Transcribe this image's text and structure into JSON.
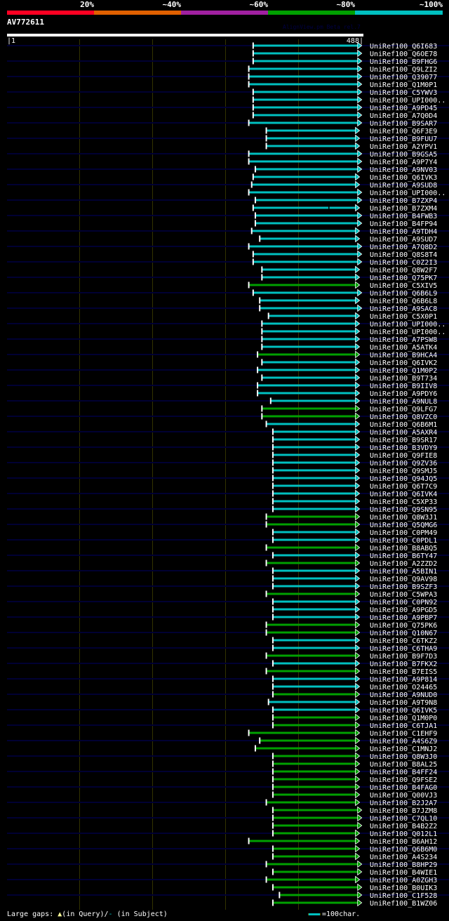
{
  "query": {
    "name": "AV772611",
    "length": 488,
    "start_label": "|1",
    "end_label": "488|"
  },
  "credit": "AlignView.pm Beta rel.7",
  "identity_bins": [
    {
      "label": "20%",
      "color": "#ff0022"
    },
    {
      "label": "~40%",
      "color": "#e06000"
    },
    {
      "label": "~60%",
      "color": "#a020a0"
    },
    {
      "label": "~80%",
      "color": "#00a000"
    },
    {
      "label": "~100%",
      "color": "#00c0c0"
    }
  ],
  "grid_every": 100,
  "footer": {
    "prefix": "Large gaps:",
    "query_gap": "▲",
    "query_text": "(in Query)/",
    "subject_gap": "-",
    "subject_text": " (in Subject)",
    "scale_label": "=100char."
  },
  "hits": [
    {
      "id": "UniRef100_Q6I683",
      "start": 338,
      "end": 481,
      "bin": "~100%"
    },
    {
      "id": "UniRef100_Q6OE78",
      "start": 338,
      "end": 481,
      "bin": "~100%"
    },
    {
      "id": "UniRef100_B9FHG6",
      "start": 338,
      "end": 481,
      "bin": "~100%"
    },
    {
      "id": "UniRef100_Q9LZI2",
      "start": 332,
      "end": 481,
      "bin": "~100%"
    },
    {
      "id": "UniRef100_Q39077",
      "start": 332,
      "end": 481,
      "bin": "~100%"
    },
    {
      "id": "UniRef100_Q1M0P1",
      "start": 332,
      "end": 481,
      "bin": "~100%"
    },
    {
      "id": "UniRef100_C5YWV3",
      "start": 338,
      "end": 481,
      "bin": "~100%"
    },
    {
      "id": "UniRef100_UPI000..",
      "start": 338,
      "end": 481,
      "bin": "~100%"
    },
    {
      "id": "UniRef100_A9PD45",
      "start": 338,
      "end": 481,
      "bin": "~100%"
    },
    {
      "id": "UniRef100_A7Q0D4",
      "start": 338,
      "end": 481,
      "bin": "~100%"
    },
    {
      "id": "UniRef100_B9SAR7",
      "start": 332,
      "end": 481,
      "bin": "~100%"
    },
    {
      "id": "UniRef100_Q6F3E9",
      "start": 356,
      "end": 478,
      "bin": "~100%"
    },
    {
      "id": "UniRef100_B9FUU7",
      "start": 356,
      "end": 478,
      "bin": "~100%"
    },
    {
      "id": "UniRef100_A2YPV1",
      "start": 356,
      "end": 478,
      "bin": "~100%"
    },
    {
      "id": "UniRef100_B9GSA5",
      "start": 332,
      "end": 481,
      "bin": "~100%"
    },
    {
      "id": "UniRef100_A9P7Y4",
      "start": 332,
      "end": 481,
      "bin": "~100%"
    },
    {
      "id": "UniRef100_A9NV03",
      "start": 341,
      "end": 481,
      "bin": "~100%"
    },
    {
      "id": "UniRef100_Q6IVK3",
      "start": 338,
      "end": 478,
      "bin": "~100%"
    },
    {
      "id": "UniRef100_A9SUD8",
      "start": 336,
      "end": 478,
      "bin": "~100%"
    },
    {
      "id": "UniRef100_UPI000..",
      "start": 332,
      "end": 481,
      "bin": "~100%"
    },
    {
      "id": "UniRef100_B7ZXP4",
      "start": 341,
      "end": 481,
      "bin": "~100%"
    },
    {
      "id": "UniRef100_B7ZXM4",
      "start": 338,
      "end": 478,
      "bin": "~100%",
      "subject_gap": 441
    },
    {
      "id": "UniRef100_B4FWB3",
      "start": 341,
      "end": 481,
      "bin": "~100%"
    },
    {
      "id": "UniRef100_B4FP94",
      "start": 341,
      "end": 481,
      "bin": "~100%"
    },
    {
      "id": "UniRef100_A9TDH4",
      "start": 336,
      "end": 478,
      "bin": "~100%"
    },
    {
      "id": "UniRef100_A9SUD7",
      "start": 347,
      "end": 478,
      "bin": "~100%"
    },
    {
      "id": "UniRef100_A7Q8D2",
      "start": 332,
      "end": 481,
      "bin": "~100%"
    },
    {
      "id": "UniRef100_Q8S8T4",
      "start": 338,
      "end": 481,
      "bin": "~100%"
    },
    {
      "id": "UniRef100_C0Z2I3",
      "start": 338,
      "end": 481,
      "bin": "~100%"
    },
    {
      "id": "UniRef100_Q8W2F7",
      "start": 350,
      "end": 478,
      "bin": "~100%"
    },
    {
      "id": "UniRef100_Q75PK7",
      "start": 350,
      "end": 478,
      "bin": "~100%"
    },
    {
      "id": "UniRef100_C5XIV5",
      "start": 332,
      "end": 478,
      "bin": "~80%"
    },
    {
      "id": "UniRef100_Q6B6L9",
      "start": 338,
      "end": 481,
      "bin": "~100%"
    },
    {
      "id": "UniRef100_Q6B6L8",
      "start": 347,
      "end": 478,
      "bin": "~100%"
    },
    {
      "id": "UniRef100_A9SAC8",
      "start": 347,
      "end": 481,
      "bin": "~100%"
    },
    {
      "id": "UniRef100_C5X0P1",
      "start": 359,
      "end": 478,
      "bin": "~100%"
    },
    {
      "id": "UniRef100_UPI000..",
      "start": 350,
      "end": 478,
      "bin": "~100%"
    },
    {
      "id": "UniRef100_UPI000..",
      "start": 350,
      "end": 478,
      "bin": "~100%"
    },
    {
      "id": "UniRef100_A7PSW8",
      "start": 350,
      "end": 478,
      "bin": "~100%"
    },
    {
      "id": "UniRef100_A5ATK4",
      "start": 350,
      "end": 478,
      "bin": "~100%"
    },
    {
      "id": "UniRef100_B9HCA4",
      "start": 344,
      "end": 478,
      "bin": "~80%"
    },
    {
      "id": "UniRef100_Q6IVK2",
      "start": 350,
      "end": 478,
      "bin": "~100%"
    },
    {
      "id": "UniRef100_Q1M0P2",
      "start": 344,
      "end": 478,
      "bin": "~100%"
    },
    {
      "id": "UniRef100_B9T734",
      "start": 350,
      "end": 478,
      "bin": "~100%"
    },
    {
      "id": "UniRef100_B9IIV8",
      "start": 344,
      "end": 478,
      "bin": "~100%"
    },
    {
      "id": "UniRef100_A9PDY6",
      "start": 344,
      "end": 478,
      "bin": "~100%"
    },
    {
      "id": "UniRef100_A9NUL8",
      "start": 362,
      "end": 478,
      "bin": "~100%"
    },
    {
      "id": "UniRef100_Q9LFG7",
      "start": 350,
      "end": 478,
      "bin": "~80%"
    },
    {
      "id": "UniRef100_Q8VZC0",
      "start": 350,
      "end": 478,
      "bin": "~80%"
    },
    {
      "id": "UniRef100_Q6B6M1",
      "start": 356,
      "end": 478,
      "bin": "~100%"
    },
    {
      "id": "UniRef100_A5AXR4",
      "start": 365,
      "end": 478,
      "bin": "~100%"
    },
    {
      "id": "UniRef100_B9SR17",
      "start": 365,
      "end": 478,
      "bin": "~100%"
    },
    {
      "id": "UniRef100_B3VDY9",
      "start": 365,
      "end": 478,
      "bin": "~100%"
    },
    {
      "id": "UniRef100_Q9FIE8",
      "start": 365,
      "end": 478,
      "bin": "~100%"
    },
    {
      "id": "UniRef100_Q9ZV36",
      "start": 365,
      "end": 478,
      "bin": "~100%"
    },
    {
      "id": "UniRef100_Q9SMJ5",
      "start": 365,
      "end": 478,
      "bin": "~100%"
    },
    {
      "id": "UniRef100_Q94JQ5",
      "start": 365,
      "end": 478,
      "bin": "~100%"
    },
    {
      "id": "UniRef100_Q6T7C9",
      "start": 365,
      "end": 478,
      "bin": "~100%"
    },
    {
      "id": "UniRef100_Q6IVK4",
      "start": 365,
      "end": 478,
      "bin": "~100%"
    },
    {
      "id": "UniRef100_C5XP33",
      "start": 365,
      "end": 478,
      "bin": "~100%"
    },
    {
      "id": "UniRef100_Q9SN95",
      "start": 365,
      "end": 478,
      "bin": "~100%"
    },
    {
      "id": "UniRef100_Q8W3J1",
      "start": 356,
      "end": 478,
      "bin": "~80%"
    },
    {
      "id": "UniRef100_Q5QMG6",
      "start": 356,
      "end": 478,
      "bin": "~80%"
    },
    {
      "id": "UniRef100_C0PM49",
      "start": 365,
      "end": 478,
      "bin": "~100%"
    },
    {
      "id": "UniRef100_C0PDL1",
      "start": 365,
      "end": 478,
      "bin": "~100%"
    },
    {
      "id": "UniRef100_B8ABQ5",
      "start": 356,
      "end": 478,
      "bin": "~80%"
    },
    {
      "id": "UniRef100_B6TY47",
      "start": 365,
      "end": 478,
      "bin": "~100%"
    },
    {
      "id": "UniRef100_A2ZZD2",
      "start": 356,
      "end": 478,
      "bin": "~80%"
    },
    {
      "id": "UniRef100_A5BIN1",
      "start": 365,
      "end": 478,
      "bin": "~100%"
    },
    {
      "id": "UniRef100_Q9AV98",
      "start": 365,
      "end": 478,
      "bin": "~100%"
    },
    {
      "id": "UniRef100_B9SZF3",
      "start": 365,
      "end": 478,
      "bin": "~100%"
    },
    {
      "id": "UniRef100_C5WPA3",
      "start": 356,
      "end": 478,
      "bin": "~80%"
    },
    {
      "id": "UniRef100_C0PN92",
      "start": 365,
      "end": 478,
      "bin": "~100%"
    },
    {
      "id": "UniRef100_A9PGD5",
      "start": 365,
      "end": 478,
      "bin": "~100%"
    },
    {
      "id": "UniRef100_A9PBP7",
      "start": 365,
      "end": 478,
      "bin": "~100%"
    },
    {
      "id": "UniRef100_Q75PK6",
      "start": 356,
      "end": 478,
      "bin": "~80%"
    },
    {
      "id": "UniRef100_Q10N67",
      "start": 356,
      "end": 478,
      "bin": "~80%"
    },
    {
      "id": "UniRef100_C6TKZ2",
      "start": 365,
      "end": 478,
      "bin": "~100%"
    },
    {
      "id": "UniRef100_C6THA9",
      "start": 365,
      "end": 478,
      "bin": "~100%"
    },
    {
      "id": "UniRef100_B9F7D3",
      "start": 356,
      "end": 478,
      "bin": "~80%"
    },
    {
      "id": "UniRef100_B7FKX2",
      "start": 365,
      "end": 478,
      "bin": "~100%"
    },
    {
      "id": "UniRef100_B7EIS5",
      "start": 356,
      "end": 478,
      "bin": "~80%"
    },
    {
      "id": "UniRef100_A9P814",
      "start": 365,
      "end": 478,
      "bin": "~100%"
    },
    {
      "id": "UniRef100_O24465",
      "start": 365,
      "end": 478,
      "bin": "~100%"
    },
    {
      "id": "UniRef100_A9NUD0",
      "start": 365,
      "end": 478,
      "bin": "~80%"
    },
    {
      "id": "UniRef100_A9T9N8",
      "start": 359,
      "end": 478,
      "bin": "~100%"
    },
    {
      "id": "UniRef100_Q6IVK5",
      "start": 365,
      "end": 478,
      "bin": "~100%"
    },
    {
      "id": "UniRef100_Q1M0P0",
      "start": 365,
      "end": 478,
      "bin": "~80%"
    },
    {
      "id": "UniRef100_C6TJA1",
      "start": 365,
      "end": 478,
      "bin": "~80%"
    },
    {
      "id": "UniRef100_C1EHF9",
      "start": 332,
      "end": 478,
      "bin": "~80%"
    },
    {
      "id": "UniRef100_A4S6Z9",
      "start": 347,
      "end": 478,
      "bin": "~80%"
    },
    {
      "id": "UniRef100_C1MNJ2",
      "start": 341,
      "end": 478,
      "bin": "~80%"
    },
    {
      "id": "UniRef100_Q8W3J0",
      "start": 365,
      "end": 478,
      "bin": "~80%"
    },
    {
      "id": "UniRef100_B8AL25",
      "start": 365,
      "end": 478,
      "bin": "~80%"
    },
    {
      "id": "UniRef100_B4FF24",
      "start": 365,
      "end": 478,
      "bin": "~80%"
    },
    {
      "id": "UniRef100_Q9FSE2",
      "start": 365,
      "end": 478,
      "bin": "~80%"
    },
    {
      "id": "UniRef100_B4FAG0",
      "start": 365,
      "end": 478,
      "bin": "~80%"
    },
    {
      "id": "UniRef100_Q00VJ3",
      "start": 365,
      "end": 478,
      "bin": "~80%"
    },
    {
      "id": "UniRef100_B2J2A7",
      "start": 356,
      "end": 478,
      "bin": "~80%"
    },
    {
      "id": "UniRef100_B7JZM8",
      "start": 365,
      "end": 481,
      "bin": "~80%"
    },
    {
      "id": "UniRef100_C7QL10",
      "start": 365,
      "end": 481,
      "bin": "~80%"
    },
    {
      "id": "UniRef100_B4B2Z2",
      "start": 365,
      "end": 481,
      "bin": "~80%"
    },
    {
      "id": "UniRef100_Q012L1",
      "start": 365,
      "end": 478,
      "bin": "~80%"
    },
    {
      "id": "UniRef100_B6AH12",
      "start": 332,
      "end": 478,
      "bin": "~80%"
    },
    {
      "id": "UniRef100_Q6B6M0",
      "start": 365,
      "end": 478,
      "bin": "~80%"
    },
    {
      "id": "UniRef100_A4S234",
      "start": 365,
      "end": 478,
      "bin": "~80%"
    },
    {
      "id": "UniRef100_B8HP29",
      "start": 356,
      "end": 481,
      "bin": "~80%"
    },
    {
      "id": "UniRef100_B4WIE1",
      "start": 365,
      "end": 481,
      "bin": "~80%"
    },
    {
      "id": "UniRef100_A0ZGH3",
      "start": 356,
      "end": 478,
      "bin": "~80%"
    },
    {
      "id": "UniRef100_B0UIK3",
      "start": 365,
      "end": 481,
      "bin": "~80%"
    },
    {
      "id": "UniRef100_C1F528",
      "start": 374,
      "end": 481,
      "bin": "~80%"
    },
    {
      "id": "UniRef100_B1WZ06",
      "start": 365,
      "end": 481,
      "bin": "~80%"
    }
  ]
}
